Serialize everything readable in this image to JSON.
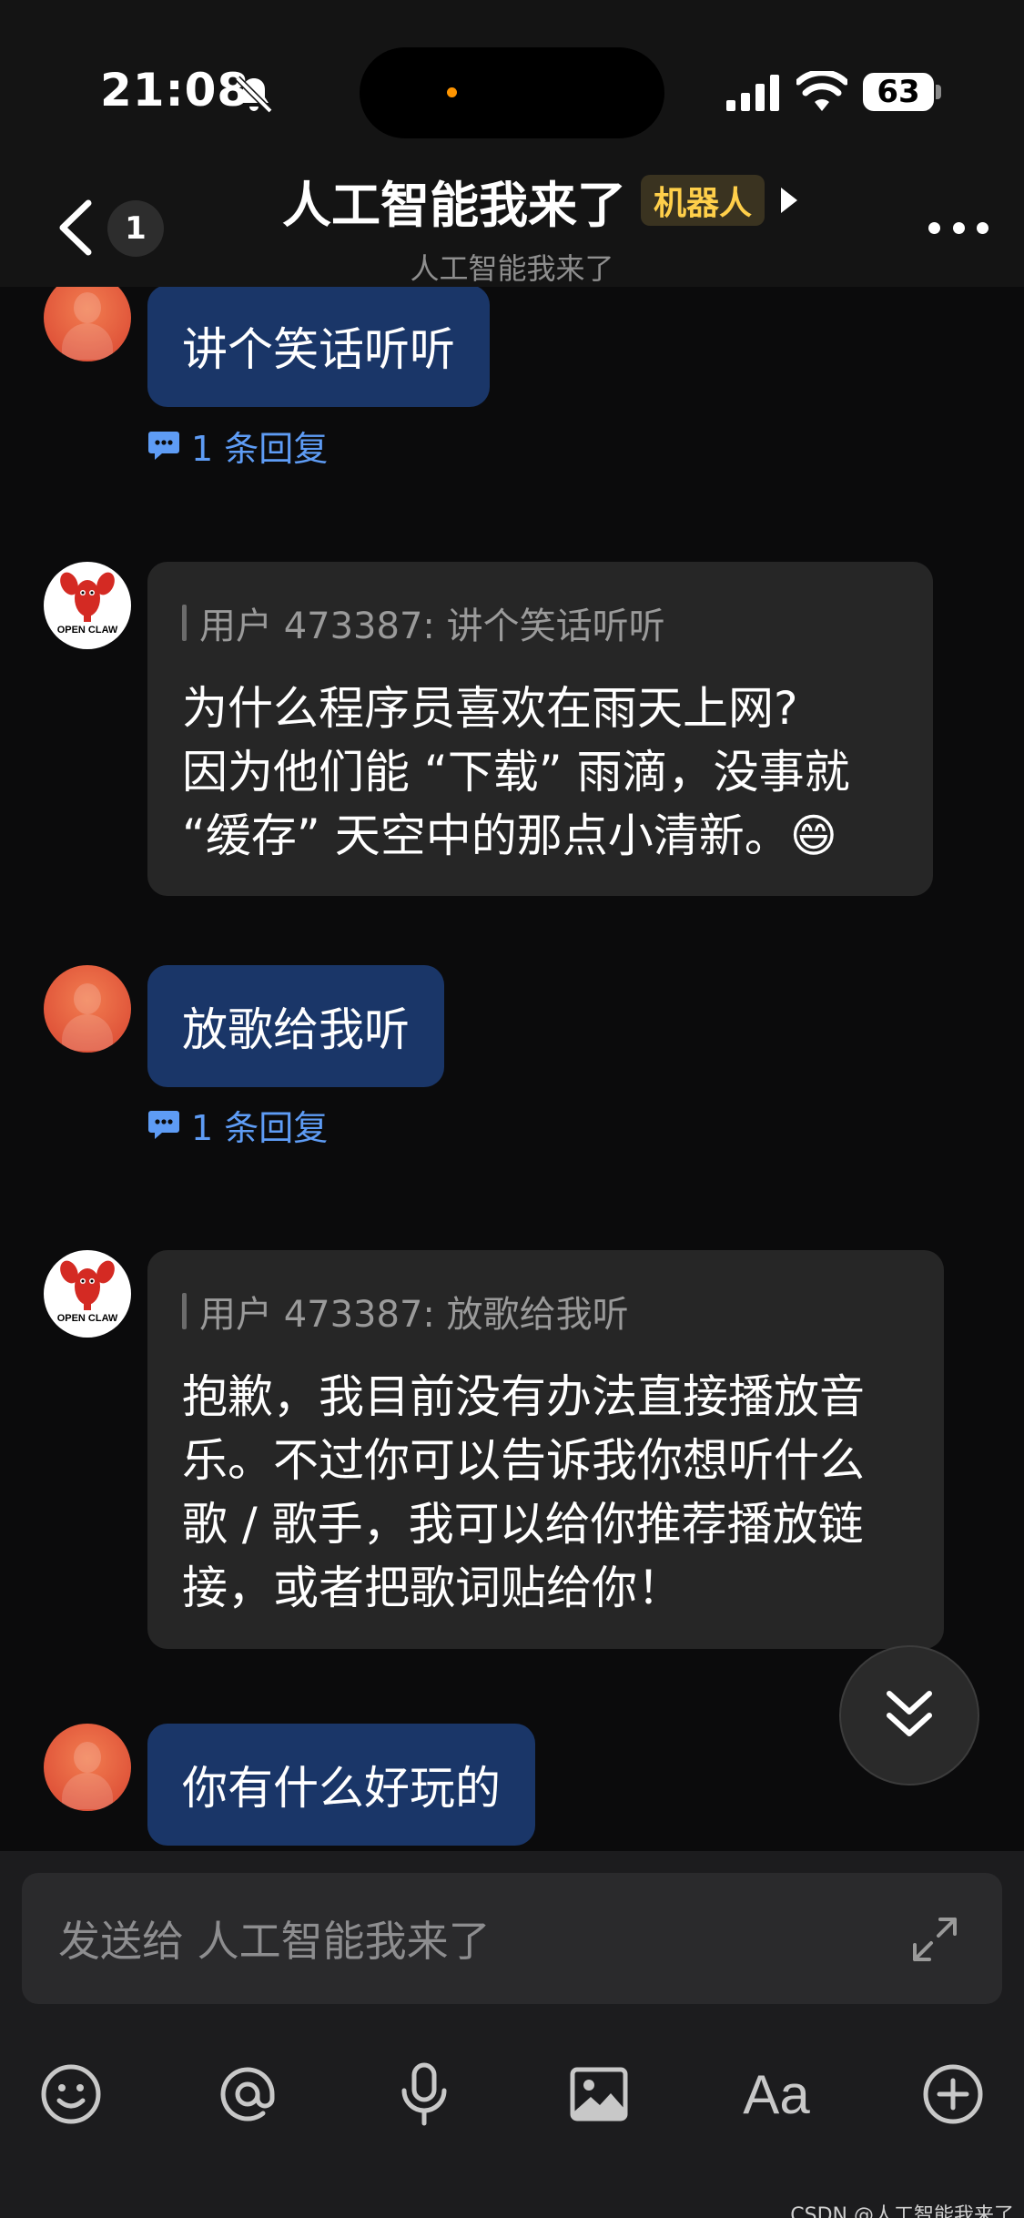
{
  "status_bar": {
    "time": "21:08",
    "battery": "63"
  },
  "header": {
    "back_badge_count": "1",
    "title": "人工智能我来了",
    "bot_badge": "机器人",
    "subtitle": "人工智能我来了"
  },
  "messages": [
    {
      "type": "user",
      "text": "讲个笑话听听",
      "replies": "1 条回复"
    },
    {
      "type": "bot",
      "avatar_text": "OPEN CLAW",
      "quote": "用户 473387: 讲个笑话听听",
      "lines": [
        "为什么程序员喜欢在雨天上网?",
        "因为他们能 “下载” 雨滴，没事就",
        "“缓存” 天空中的那点小清新。😄"
      ]
    },
    {
      "type": "user",
      "text": "放歌给我听",
      "replies": "1 条回复"
    },
    {
      "type": "bot",
      "avatar_text": "OPEN CLAW",
      "quote": "用户 473387: 放歌给我听",
      "lines": [
        "抱歉，我目前没有办法直接播放音",
        "乐。不过你可以告诉我你想听什么",
        "歌 / 歌手，我可以给你推荐播放链",
        "接，或者把歌词贴给你！"
      ]
    },
    {
      "type": "user",
      "text": "你有什么好玩的"
    }
  ],
  "composer": {
    "placeholder": "发送给 人工智能我来了",
    "tools": [
      "emoji-icon",
      "mention-icon",
      "microphone-icon",
      "image-icon",
      "font-icon",
      "add-icon"
    ],
    "font_tool_label": "Aa"
  },
  "watermark": "CSDN @人工智能我来了",
  "colors": {
    "user_bubble": "#1a3668",
    "bot_bubble": "#262626",
    "link": "#5e9cf5",
    "bot_badge": "#ffcf4a"
  }
}
